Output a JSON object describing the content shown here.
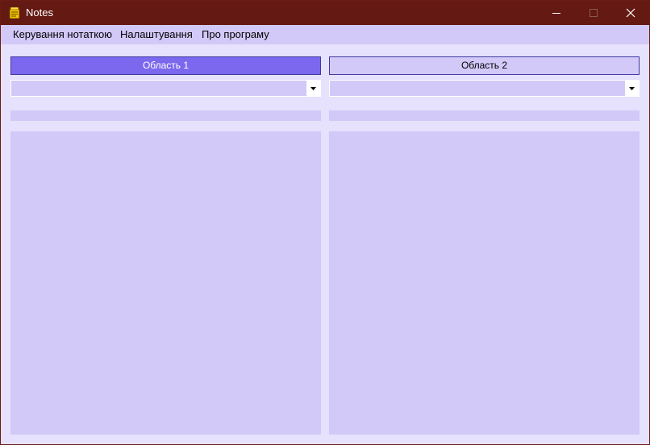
{
  "window": {
    "title": "Notes",
    "app_icon": "notes-app-icon",
    "controls": {
      "minimize_icon": "minimize-icon",
      "maximize_icon": "maximize-icon",
      "close_icon": "close-icon"
    }
  },
  "menu": {
    "items": [
      {
        "label": "Керування нотаткою"
      },
      {
        "label": "Налаштування"
      },
      {
        "label": "Про програму"
      }
    ]
  },
  "areas": [
    {
      "label": "Область 1",
      "selected_value": "",
      "active": true
    },
    {
      "label": "Область 2",
      "selected_value": "",
      "active": false
    }
  ],
  "colors": {
    "titlebar": "#641913",
    "background": "#e6e1fc",
    "surface": "#d2c9f8",
    "active_button": "#7b68ee"
  }
}
